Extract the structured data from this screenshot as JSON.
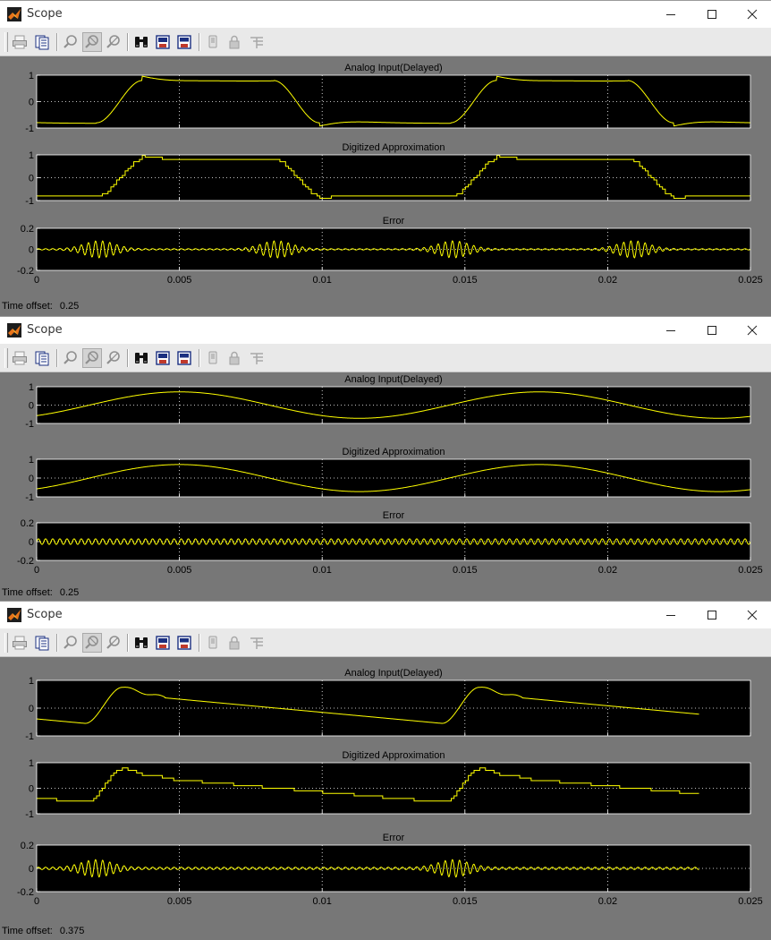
{
  "colors": {
    "background": "#777777",
    "plot_background": "#000000",
    "trace": "#ffff00",
    "grid": "#ffffff",
    "titlebar": "#ffffff",
    "toolbar": "#e9e9e9"
  },
  "icons": [
    "matlab-icon",
    "print-icon",
    "parameters-icon",
    "zoom-icon",
    "zoom-x-icon",
    "zoom-y-icon",
    "binoculars-icon",
    "save-axes-icon",
    "restore-axes-icon",
    "floating-scope-icon",
    "lock-icon",
    "signal-selection-icon",
    "minimize-icon",
    "maximize-icon",
    "close-icon"
  ],
  "windows": [
    {
      "title": "Scope",
      "time_offset_label": "Time offset:",
      "time_offset_value": "0.25",
      "chart_data": [
        {
          "type": "line",
          "title": "Analog Input(Delayed)",
          "xlim": [
            0,
            0.025
          ],
          "ylim": [
            -1,
            1
          ],
          "yticks": [
            1,
            0,
            -1
          ],
          "xticks": [
            0,
            0.005,
            0.01,
            0.015,
            0.02,
            0.025
          ],
          "grid": true,
          "variant": "square_smooth",
          "period": 0.0124,
          "phase": 0.0021,
          "t_end": 0.025,
          "wiggle": 0.08
        },
        {
          "type": "line",
          "title": "Digitized Approximation",
          "xlim": [
            0,
            0.025
          ],
          "ylim": [
            -1,
            1
          ],
          "yticks": [
            1,
            0,
            -1
          ],
          "xticks": [
            0,
            0.005,
            0.01,
            0.015,
            0.02,
            0.025
          ],
          "grid": true,
          "variant": "square_stair",
          "period": 0.0124,
          "phase": 0.0021,
          "t_end": 0.025,
          "wiggle": 0.08,
          "q_step": 0.1
        },
        {
          "type": "line",
          "title": "Error",
          "xlim": [
            0,
            0.025
          ],
          "ylim": [
            -0.2,
            0.2
          ],
          "yticks": [
            0.2,
            0,
            -0.2
          ],
          "xticks": [
            0,
            0.005,
            0.01,
            0.015,
            0.02,
            0.025
          ],
          "xtick_labels": [
            "0",
            "0.005",
            "0.01",
            "0.015",
            "0.02",
            "0.025"
          ],
          "grid": true,
          "variant": "error_bursts",
          "burst_centers": [
            0.0022,
            0.0084,
            0.0146,
            0.0209
          ],
          "burst_amplitude": 0.075,
          "baseline_amplitude": 0.006,
          "t_end": 0.025
        }
      ]
    },
    {
      "title": "Scope",
      "time_offset_label": "Time offset:",
      "time_offset_value": "0.25",
      "chart_data": [
        {
          "type": "line",
          "title": "Analog Input(Delayed)",
          "xlim": [
            0,
            0.025
          ],
          "ylim": [
            -1,
            1
          ],
          "yticks": [
            1,
            0,
            -1
          ],
          "xticks": [
            0,
            0.005,
            0.01,
            0.015,
            0.02,
            0.025
          ],
          "grid": true,
          "variant": "sine",
          "period": 0.0126,
          "peak_time": 0.005,
          "amplitude": 0.72,
          "t_end": 0.025
        },
        {
          "type": "line",
          "title": "Digitized Approximation",
          "xlim": [
            0,
            0.025
          ],
          "ylim": [
            -1,
            1
          ],
          "yticks": [
            1,
            0,
            -1
          ],
          "xticks": [
            0,
            0.005,
            0.01,
            0.015,
            0.02,
            0.025
          ],
          "grid": true,
          "variant": "sine",
          "period": 0.0126,
          "peak_time": 0.005,
          "amplitude": 0.72,
          "t_end": 0.025
        },
        {
          "type": "line",
          "title": "Error",
          "xlim": [
            0,
            0.025
          ],
          "ylim": [
            -0.2,
            0.2
          ],
          "yticks": [
            0.2,
            0,
            -0.2
          ],
          "xticks": [
            0,
            0.005,
            0.01,
            0.015,
            0.02,
            0.025
          ],
          "xtick_labels": [
            "0",
            "0.005",
            "0.01",
            "0.015",
            "0.02",
            "0.025"
          ],
          "grid": true,
          "variant": "error_uniform",
          "baseline_amplitude": 0.03,
          "t_end": 0.025
        }
      ]
    },
    {
      "title": "Scope",
      "time_offset_label": "Time offset:",
      "time_offset_value": "0.375",
      "chart_data": [
        {
          "type": "line",
          "title": "Analog Input(Delayed)",
          "xlim": [
            0,
            0.025
          ],
          "ylim": [
            -1,
            1
          ],
          "yticks": [
            1,
            0,
            -1
          ],
          "xticks": [
            0,
            0.005,
            0.01,
            0.015,
            0.02,
            0.025
          ],
          "grid": true,
          "variant": "sawtooth_smooth",
          "period": 0.0125,
          "t_end": 0.0232
        },
        {
          "type": "line",
          "title": "Digitized Approximation",
          "xlim": [
            0,
            0.025
          ],
          "ylim": [
            -1,
            1
          ],
          "yticks": [
            1,
            0,
            -1
          ],
          "xticks": [
            0,
            0.005,
            0.01,
            0.015,
            0.02,
            0.025
          ],
          "grid": true,
          "variant": "sawtooth_stair",
          "period": 0.0125,
          "t_end": 0.0232,
          "q_step": 0.1
        },
        {
          "type": "line",
          "title": "Error",
          "xlim": [
            0,
            0.025
          ],
          "ylim": [
            -0.2,
            0.2
          ],
          "yticks": [
            0.2,
            0,
            -0.2
          ],
          "xticks": [
            0,
            0.005,
            0.01,
            0.015,
            0.02,
            0.025
          ],
          "xtick_labels": [
            "0",
            "0.005",
            "0.01",
            "0.015",
            "0.02",
            "0.025"
          ],
          "grid": true,
          "variant": "error_bursts",
          "burst_centers": [
            0.0021,
            0.0146
          ],
          "burst_amplitude": 0.065,
          "baseline_amplitude": 0.01,
          "t_end": 0.0232
        }
      ]
    }
  ]
}
